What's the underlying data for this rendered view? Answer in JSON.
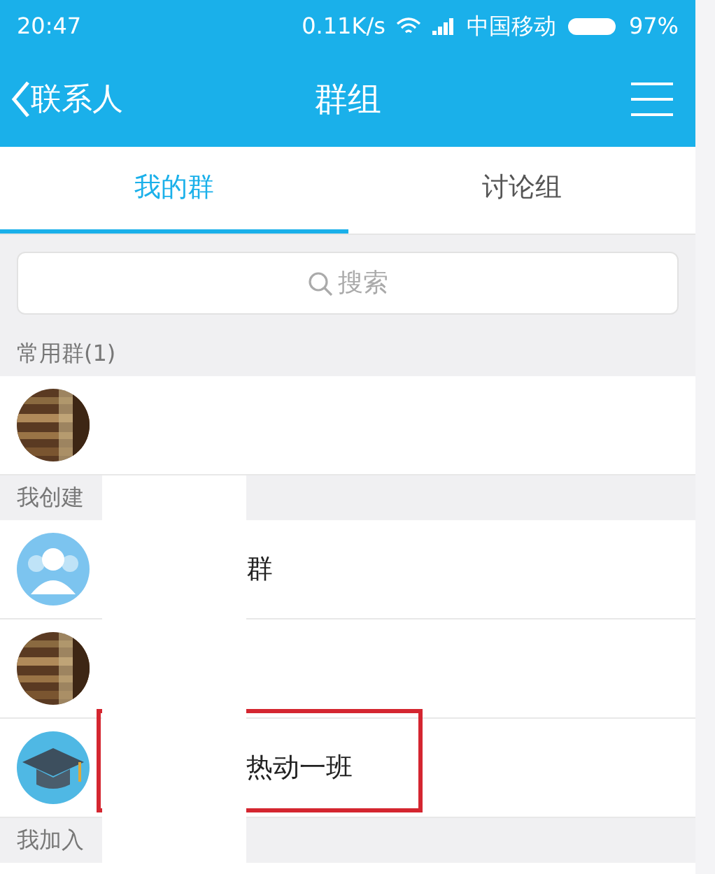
{
  "status_bar": {
    "time": "20:47",
    "speed": "0.11K/s",
    "carrier": "中国移动",
    "battery": "97%"
  },
  "nav": {
    "back": "联系人",
    "title": "群组"
  },
  "tabs": [
    {
      "label": "我的群",
      "selected": true
    },
    {
      "label": "讨论组",
      "selected": false
    }
  ],
  "search": {
    "placeholder": "搜索"
  },
  "sections": [
    {
      "title": "常用群(1)",
      "groups": [
        {
          "kind": "picture",
          "highlighted": false
        }
      ]
    },
    {
      "title": "我创建",
      "groups": [
        {
          "kind": "people",
          "name": "群",
          "highlighted": false
        },
        {
          "kind": "picture",
          "highlighted": false
        },
        {
          "kind": "cap",
          "name": "热动一班",
          "highlighted": true
        }
      ]
    },
    {
      "title": "我加入"
    }
  ]
}
